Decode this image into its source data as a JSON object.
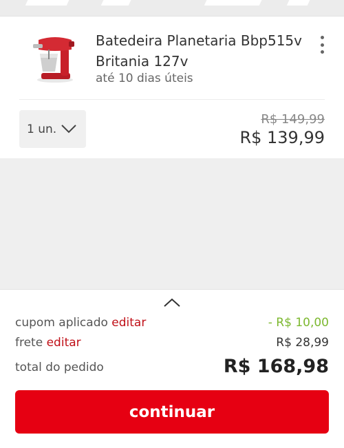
{
  "product": {
    "name": "Batedeira Planetaria Bbp515v Britania 127v",
    "delivery": "até 10 dias úteis",
    "quantity": "1 un.",
    "price_old": "R$ 149,99",
    "price_now": "R$ 139,99",
    "image_color": "#c8202a"
  },
  "summary": {
    "coupon_label": "cupom aplicado",
    "coupon_edit": "editar",
    "coupon_value": "- R$ 10,00",
    "shipping_label": "frete",
    "shipping_edit": "editar",
    "shipping_value": "R$ 28,99",
    "total_label": "total do pedido",
    "total_value": "R$ 168,98"
  },
  "actions": {
    "continue_label": "continuar"
  },
  "colors": {
    "brand_red": "#e60012",
    "edit_link": "#c01018",
    "discount_green": "#7cb82f"
  }
}
